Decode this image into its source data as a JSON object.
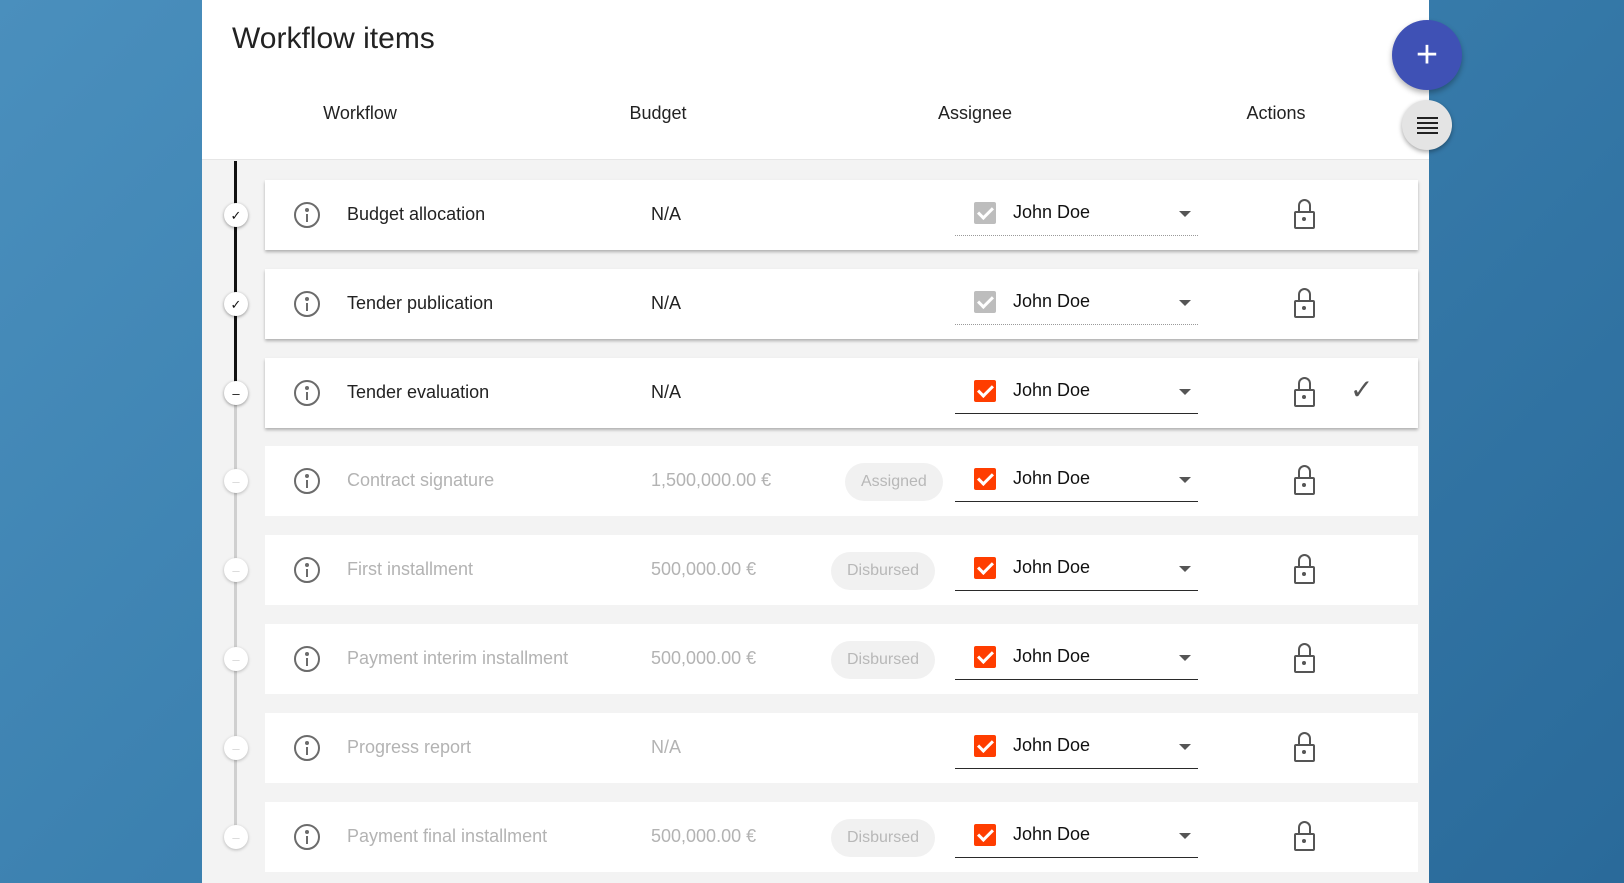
{
  "page": {
    "title": "Workflow items"
  },
  "columns": {
    "workflow": "Workflow",
    "budget": "Budget",
    "assignee": "Assignee",
    "actions": "Actions"
  },
  "fab": {
    "add_icon": "plus-icon",
    "add_glyph": "+",
    "list_icon": "list-icon"
  },
  "colors": {
    "accent": "#3f51b5",
    "checkbox_active": "#ff3d00",
    "checkbox_disabled": "#bdbdbd",
    "background": "#3a7fae"
  },
  "items": [
    {
      "name": "Budget allocation",
      "budget": "N/A",
      "badge": "",
      "assignee": "John Doe",
      "status": "done"
    },
    {
      "name": "Tender publication",
      "budget": "N/A",
      "badge": "",
      "assignee": "John Doe",
      "status": "done"
    },
    {
      "name": "Tender evaluation",
      "budget": "N/A",
      "badge": "",
      "assignee": "John Doe",
      "status": "open"
    },
    {
      "name": "Contract signature",
      "budget": "1,500,000.00 €",
      "badge": "Assigned",
      "assignee": "John Doe",
      "status": "pending"
    },
    {
      "name": "First installment",
      "budget": "500,000.00 €",
      "badge": "Disbursed",
      "assignee": "John Doe",
      "status": "pending"
    },
    {
      "name": "Payment interim installment",
      "budget": "500,000.00 €",
      "badge": "Disbursed",
      "assignee": "John Doe",
      "status": "pending"
    },
    {
      "name": "Progress report",
      "budget": "N/A",
      "badge": "",
      "assignee": "John Doe",
      "status": "pending"
    },
    {
      "name": "Payment final installment",
      "budget": "500,000.00 €",
      "badge": "Disbursed",
      "assignee": "John Doe",
      "status": "pending"
    }
  ]
}
